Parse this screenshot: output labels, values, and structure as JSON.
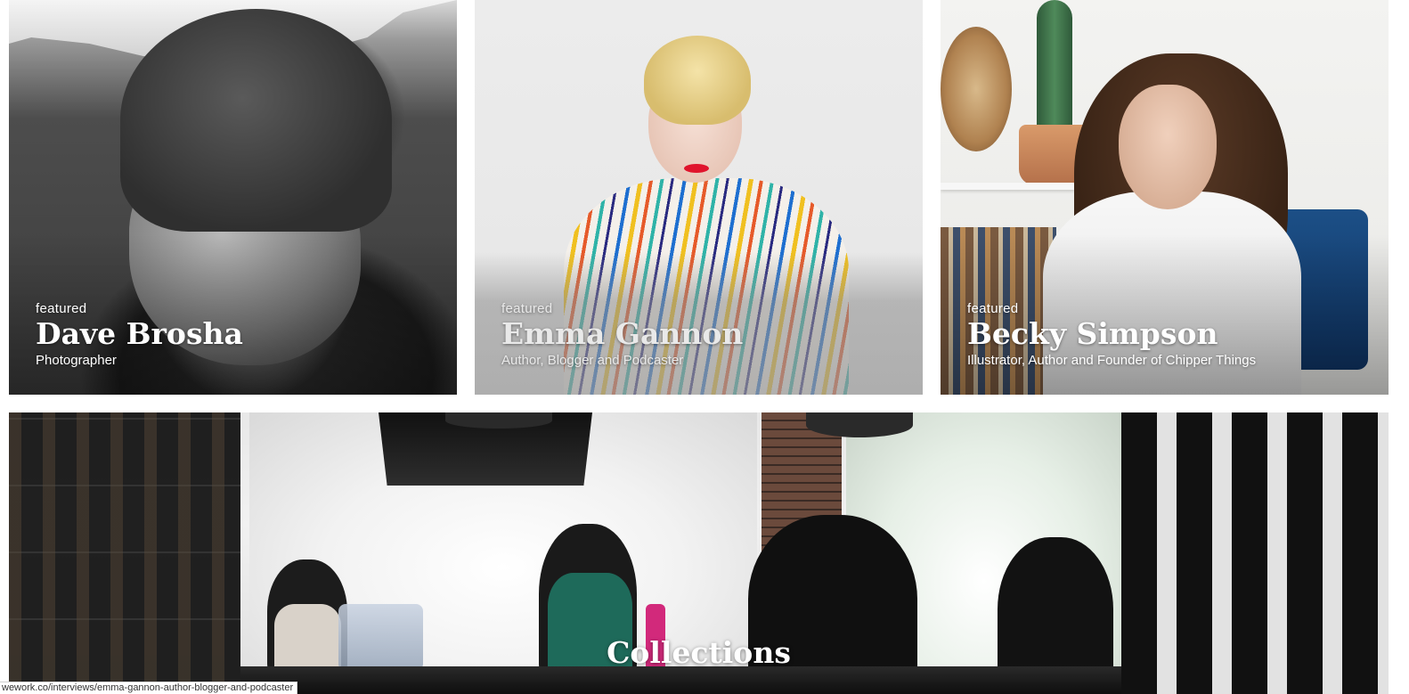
{
  "featured_cards": [
    {
      "tag": "featured",
      "name": "Dave Brosha",
      "role": "Photographer",
      "photo_icon": "portrait-photo-grayscale"
    },
    {
      "tag": "featured",
      "name": "Emma Gannon",
      "role": "Author, Blogger and Podcaster",
      "photo_icon": "portrait-photo-studio"
    },
    {
      "tag": "featured",
      "name": "Becky Simpson",
      "role": "Illustrator, Author and Founder of Chipper Things",
      "photo_icon": "portrait-photo-interior"
    }
  ],
  "collections_banner": {
    "title": "Collections",
    "photo_icon": "cafe-interior-photo"
  },
  "status_bar": {
    "url": "wework.co/interviews/emma-gannon-author-blogger-and-podcaster"
  },
  "colors": {
    "page_background": "#ffffff",
    "card_text": "#ffffff",
    "accent_red": "#e0142c"
  }
}
